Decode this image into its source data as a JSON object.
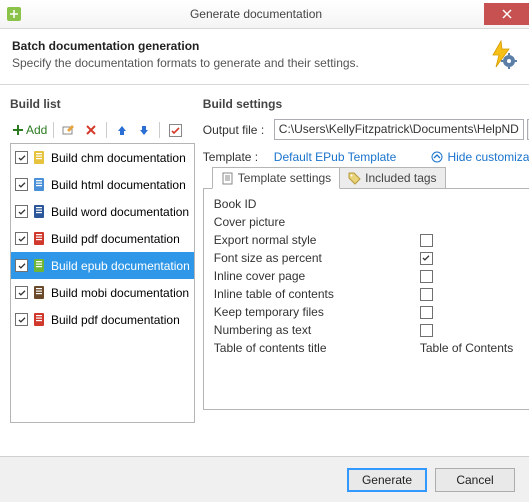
{
  "title": "Generate documentation",
  "header": {
    "h1": "Batch documentation generation",
    "sub": "Specify the documentation formats to generate and their settings."
  },
  "buildList": {
    "title": "Build list",
    "addLabel": "Add",
    "items": [
      {
        "label": "Build chm documentation",
        "checked": true,
        "selected": false,
        "iconColor": "#e6c23d"
      },
      {
        "label": "Build html documentation",
        "checked": true,
        "selected": false,
        "iconColor": "#4a90d9"
      },
      {
        "label": "Build word documentation",
        "checked": true,
        "selected": false,
        "iconColor": "#2b579a"
      },
      {
        "label": "Build pdf documentation",
        "checked": true,
        "selected": false,
        "iconColor": "#d0382b"
      },
      {
        "label": "Build epub documentation",
        "checked": true,
        "selected": true,
        "iconColor": "#6fb536"
      },
      {
        "label": "Build mobi documentation",
        "checked": true,
        "selected": false,
        "iconColor": "#6a4a2a"
      },
      {
        "label": "Build pdf documentation",
        "checked": true,
        "selected": false,
        "iconColor": "#d0382b"
      }
    ]
  },
  "buildSettings": {
    "title": "Build settings",
    "outputLabel": "Output file :",
    "outputValue": "C:\\Users\\KellyFitzpatrick\\Documents\\HelpND",
    "templateLabel": "Template :",
    "templateValue": "Default EPub Template",
    "hideLink": "Hide customization",
    "tabs": {
      "t1": "Template settings",
      "t2": "Included tags"
    },
    "settings": [
      {
        "label": "Book ID",
        "checkbox": false,
        "checked": false,
        "value": ""
      },
      {
        "label": "Cover picture",
        "checkbox": false,
        "checked": false,
        "value": ""
      },
      {
        "label": "Export normal style",
        "checkbox": true,
        "checked": false,
        "value": ""
      },
      {
        "label": "Font size as percent",
        "checkbox": true,
        "checked": true,
        "value": ""
      },
      {
        "label": "Inline cover page",
        "checkbox": true,
        "checked": false,
        "value": ""
      },
      {
        "label": "Inline table of contents",
        "checkbox": true,
        "checked": false,
        "value": ""
      },
      {
        "label": "Keep temporary files",
        "checkbox": true,
        "checked": false,
        "value": ""
      },
      {
        "label": "Numbering as text",
        "checkbox": true,
        "checked": false,
        "value": ""
      },
      {
        "label": "Table of contents title",
        "checkbox": false,
        "checked": false,
        "value": "Table of Contents"
      }
    ]
  },
  "footer": {
    "generate": "Generate",
    "cancel": "Cancel"
  }
}
